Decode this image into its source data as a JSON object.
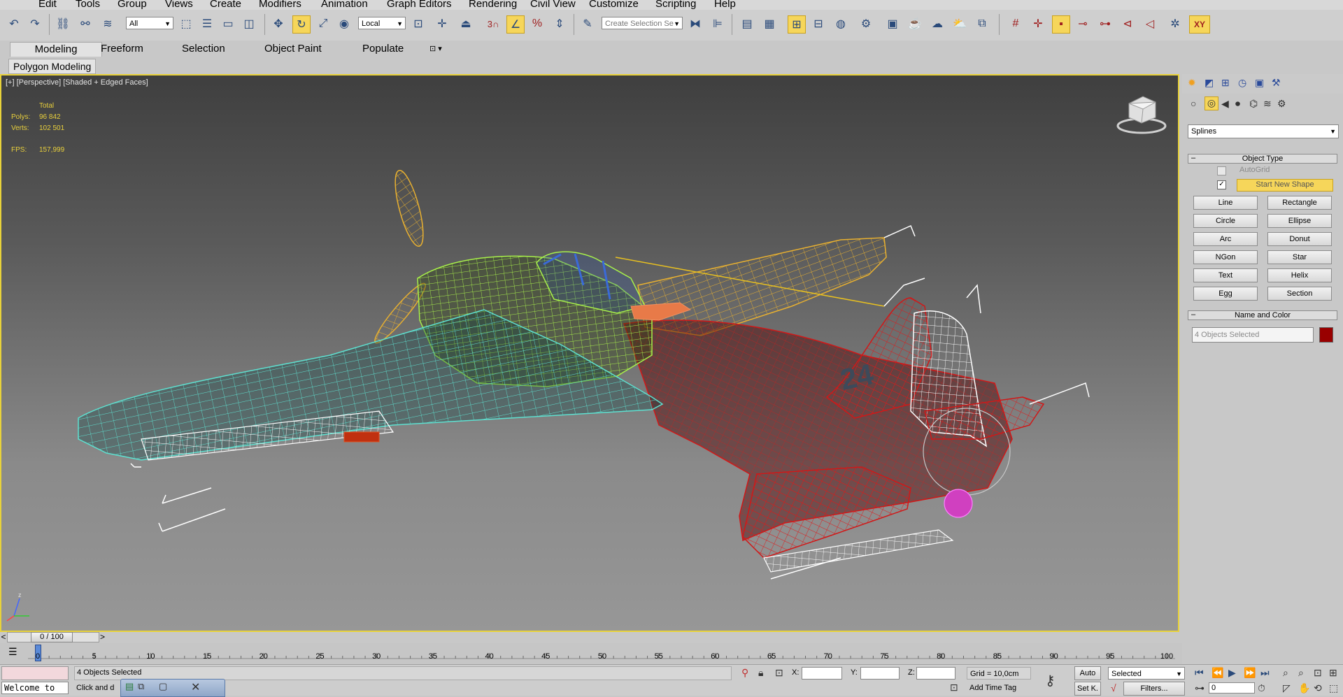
{
  "menu": [
    "Edit",
    "Tools",
    "Group",
    "Views",
    "Create",
    "Modifiers",
    "Animation",
    "Graph Editors",
    "Rendering",
    "Civil View",
    "Customize",
    "Scripting",
    "Help"
  ],
  "toolbar": {
    "selection_filter": "All",
    "ref_coord": "Local",
    "named_selection_placeholder": "Create Selection Se",
    "snap_3": "3",
    "axis_label": "XY"
  },
  "ribbon": {
    "tabs": [
      "Modeling",
      "Freeform",
      "Selection",
      "Object Paint",
      "Populate"
    ],
    "active_tab": "Modeling",
    "subtab": "Polygon Modeling"
  },
  "viewport": {
    "label": "[+] [Perspective] [Shaded + Edged Faces]",
    "stats": {
      "total_label": "Total",
      "polys_label": "Polys:",
      "polys_value": "96 842",
      "verts_label": "Verts:",
      "verts_value": "102 501",
      "fps_label": "FPS:",
      "fps_value": "157,999"
    },
    "tail_number": "24",
    "gizmo_label": "z"
  },
  "command_panel": {
    "category": "Splines",
    "object_type_title": "Object Type",
    "autogrid": "AutoGrid",
    "autogrid_checked": false,
    "start_new_shape": "Start New Shape",
    "start_new_shape_checked": true,
    "buttons": [
      "Line",
      "Rectangle",
      "Circle",
      "Ellipse",
      "Arc",
      "Donut",
      "NGon",
      "Star",
      "Text",
      "Helix",
      "Egg",
      "Section"
    ],
    "name_color_title": "Name and Color",
    "name_value": "4 Objects Selected",
    "object_color": "#990000"
  },
  "timeline": {
    "frame": "0 / 100",
    "ticks": [
      "0",
      "5",
      "10",
      "15",
      "20",
      "25",
      "30",
      "35",
      "40",
      "45",
      "50",
      "55",
      "60",
      "65",
      "70",
      "75",
      "80",
      "85",
      "90",
      "95",
      "100"
    ]
  },
  "status": {
    "script_welcome": "Welcome to",
    "selection_count": "4 Objects Selected",
    "prompt": "Click and d",
    "x_label": "X:",
    "y_label": "Y:",
    "z_label": "Z:",
    "grid": "Grid = 10,0cm",
    "add_time_tag": "Add Time Tag",
    "auto_key": "Auto",
    "set_key": "Set K.",
    "key_filter": "Selected",
    "filters": "Filters...",
    "frame_field": "0"
  }
}
